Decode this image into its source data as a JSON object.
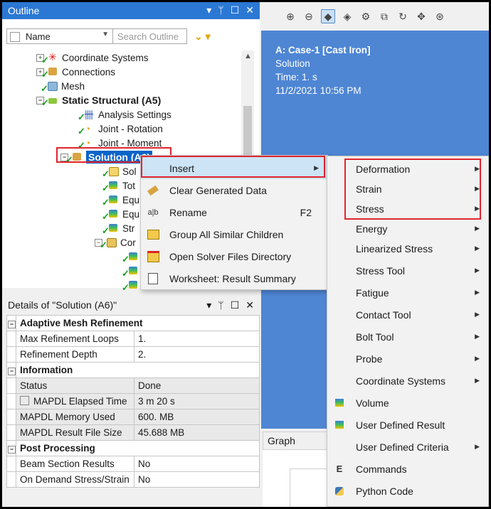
{
  "outline": {
    "title": "Outline",
    "filter_select": "Name",
    "search_placeholder": "Search Outline",
    "controls": [
      "▾",
      "ᛘ",
      "☐",
      "✕"
    ],
    "tree": [
      {
        "label": "Coordinate Systems",
        "icon": "coordinate-systems-icon"
      },
      {
        "label": "Connections",
        "icon": "connections-icon"
      },
      {
        "label": "Mesh",
        "icon": "mesh-icon"
      },
      {
        "label": "Static Structural (A5)",
        "icon": "static-structural-icon"
      },
      {
        "label": "Analysis Settings",
        "icon": "analysis-settings-icon"
      },
      {
        "label": "Joint - Rotation",
        "icon": "joint-rotation-icon"
      },
      {
        "label": "Joint - Moment",
        "icon": "joint-moment-icon"
      },
      {
        "label": "Solution (A6)",
        "icon": "solution-icon"
      },
      {
        "label": "Sol",
        "icon": "solution-info-icon"
      },
      {
        "label": "Tot",
        "icon": "result-icon"
      },
      {
        "label": "Equ",
        "icon": "result-icon"
      },
      {
        "label": "Equ",
        "icon": "result-icon"
      },
      {
        "label": "Str",
        "icon": "result-icon"
      },
      {
        "label": "Cor",
        "icon": "folder-icon"
      }
    ]
  },
  "graphics": {
    "info_title": "A: Case-1 [Cast Iron]",
    "info_type": "Solution",
    "info_time": "Time: 1. s",
    "info_date": "11/2/2021 10:56 PM"
  },
  "details": {
    "title": "Details of \"Solution (A6)\"",
    "groups": [
      {
        "name": "Adaptive Mesh Refinement",
        "rows": [
          {
            "label": "Max Refinement Loops",
            "value": "1."
          },
          {
            "label": "Refinement Depth",
            "value": "2."
          }
        ]
      },
      {
        "name": "Information",
        "rows": [
          {
            "label": "Status",
            "value": "Done"
          },
          {
            "label": "MAPDL Elapsed Time",
            "value": "3 m 20 s"
          },
          {
            "label": "MAPDL Memory Used",
            "value": "600. MB"
          },
          {
            "label": "MAPDL Result File Size",
            "value": "45.688 MB"
          }
        ]
      },
      {
        "name": "Post Processing",
        "rows": [
          {
            "label": "Beam Section Results",
            "value": "No"
          },
          {
            "label": "On Demand Stress/Strain",
            "value": "No"
          }
        ]
      }
    ]
  },
  "graph_tab": "Graph",
  "context_menu": [
    {
      "label": "Insert",
      "icon": "",
      "shortcut": "",
      "submenu": true
    },
    {
      "label": "Clear Generated Data",
      "icon": "eraser-icon",
      "shortcut": ""
    },
    {
      "label": "Rename",
      "icon": "rename-icon",
      "shortcut": "F2"
    },
    {
      "label": "Group All Similar Children",
      "icon": "folder-icon",
      "shortcut": ""
    },
    {
      "label": "Open Solver Files Directory",
      "icon": "open-folder-icon",
      "shortcut": ""
    },
    {
      "label": "Worksheet: Result Summary",
      "icon": "worksheet-icon",
      "shortcut": ""
    }
  ],
  "insert_menu": [
    {
      "label": "Deformation",
      "submenu": true
    },
    {
      "label": "Strain",
      "submenu": true
    },
    {
      "label": "Stress",
      "submenu": true
    },
    {
      "label": "Energy",
      "submenu": true
    },
    {
      "label": "Linearized Stress",
      "submenu": true
    },
    {
      "label": "Stress Tool",
      "submenu": true
    },
    {
      "label": "Fatigue",
      "submenu": true
    },
    {
      "label": "Contact Tool",
      "submenu": true
    },
    {
      "label": "Bolt Tool",
      "submenu": true
    },
    {
      "label": "Probe",
      "submenu": true
    },
    {
      "label": "Coordinate Systems",
      "submenu": true
    },
    {
      "label": "Volume",
      "submenu": false,
      "icon": "volume-icon"
    },
    {
      "label": "User Defined Result",
      "submenu": false,
      "icon": "user-defined-result-icon"
    },
    {
      "label": "User Defined Criteria",
      "submenu": true
    },
    {
      "label": "Commands",
      "submenu": false,
      "icon": "commands-icon"
    },
    {
      "label": "Python Code",
      "submenu": false,
      "icon": "python-code-icon"
    }
  ],
  "colors": {
    "title_bar": "#2b78d4",
    "viewport": "#4e86d4",
    "highlight": "#e0252f",
    "menu_hover": "#cde4f7"
  }
}
